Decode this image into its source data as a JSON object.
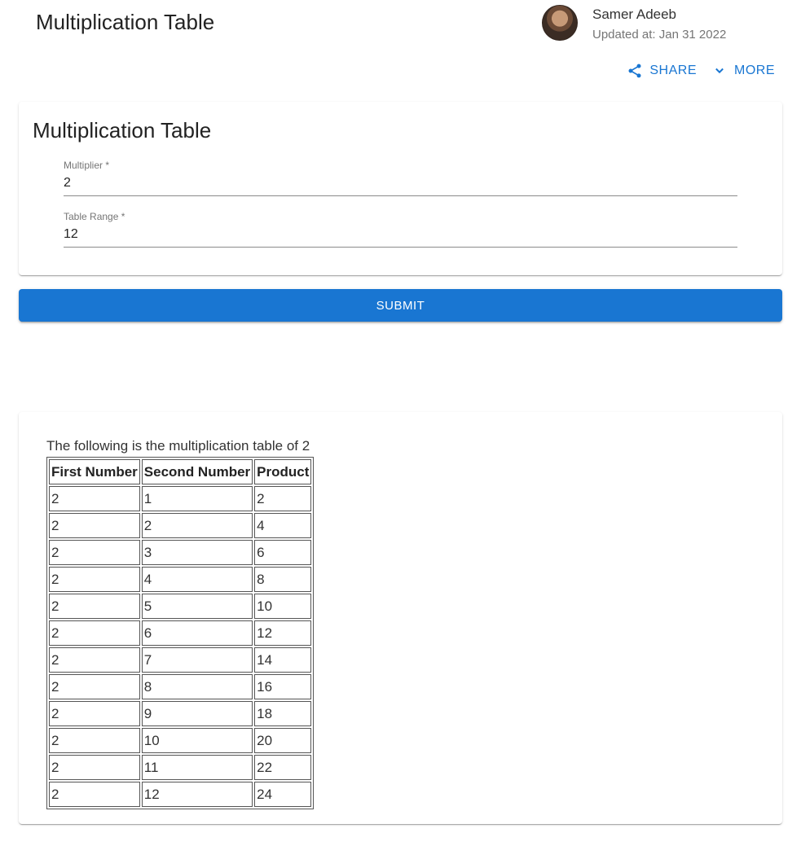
{
  "header": {
    "title": "Multiplication Table",
    "author_name": "Samer Adeeb",
    "updated": "Updated at: Jan 31 2022"
  },
  "actions": {
    "share_label": "SHARE",
    "more_label": "MORE"
  },
  "form": {
    "title": "Multiplication Table",
    "multiplier_label": "Multiplier *",
    "multiplier_value": "2",
    "range_label": "Table Range *",
    "range_value": "12",
    "submit_label": "SUBMIT"
  },
  "result": {
    "caption": "The following is the multiplication table of 2",
    "headers": [
      "First Number",
      "Second Number",
      "Product"
    ],
    "rows": [
      [
        "2",
        "1",
        "2"
      ],
      [
        "2",
        "2",
        "4"
      ],
      [
        "2",
        "3",
        "6"
      ],
      [
        "2",
        "4",
        "8"
      ],
      [
        "2",
        "5",
        "10"
      ],
      [
        "2",
        "6",
        "12"
      ],
      [
        "2",
        "7",
        "14"
      ],
      [
        "2",
        "8",
        "16"
      ],
      [
        "2",
        "9",
        "18"
      ],
      [
        "2",
        "10",
        "20"
      ],
      [
        "2",
        "11",
        "22"
      ],
      [
        "2",
        "12",
        "24"
      ]
    ]
  },
  "colors": {
    "accent": "#1976d2"
  }
}
